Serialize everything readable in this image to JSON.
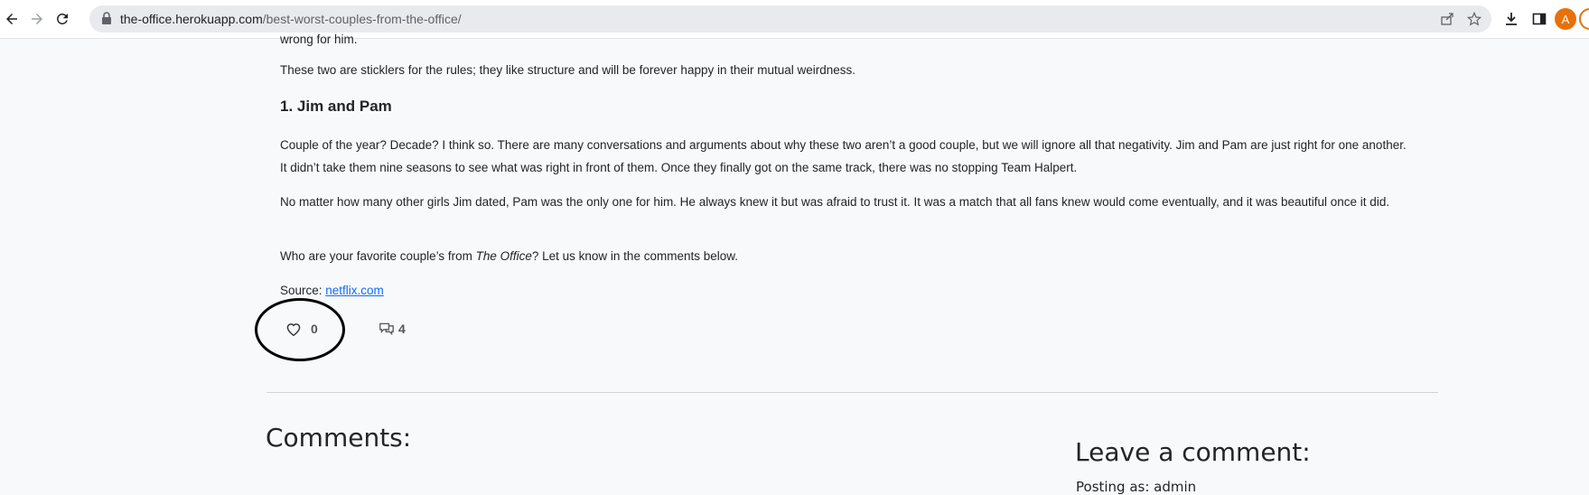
{
  "browser": {
    "url_host": "the-office.herokuapp.com",
    "url_path": "/best-worst-couples-from-the-office/",
    "avatar_letter": "A"
  },
  "article": {
    "fragment_top": "wrong for him.",
    "paragraph_1": "These two are sticklers for the rules; they like structure and will be forever happy in their mutual weirdness.",
    "heading": "1. Jim and Pam",
    "paragraph_2": "Couple of the year? Decade? I think so. There are many conversations and arguments about why these two aren’t a good couple, but we will ignore all that negativity. Jim and Pam are just right for one another. It didn’t take them nine seasons to see what was right in front of them. Once they finally got on the same track, there was no stopping Team Halpert.",
    "paragraph_3": "No matter how many other girls Jim dated, Pam was the only one for him. He always knew it but was afraid to trust it. It was a match that all fans knew would come eventually, and it was beautiful once it did.",
    "paragraph_4_pre": "Who are your favorite couple’s from ",
    "paragraph_4_em": "The Office",
    "paragraph_4_post": "? Let us know in the comments below.",
    "source_label": "Source: ",
    "source_link": "netflix.com"
  },
  "stats": {
    "likes": "0",
    "comments": "4"
  },
  "comments_section": {
    "title": "Comments:",
    "leave_title": "Leave a comment:",
    "posting_as": "Posting as: admin"
  },
  "icons": {
    "back": "back-arrow-icon",
    "forward": "forward-arrow-icon",
    "reload": "reload-icon",
    "lock": "lock-icon",
    "share": "share-icon",
    "bookmark": "star-icon",
    "download": "download-icon",
    "sidepanel": "side-panel-icon",
    "like": "heart-icon",
    "comment": "comment-icon"
  }
}
